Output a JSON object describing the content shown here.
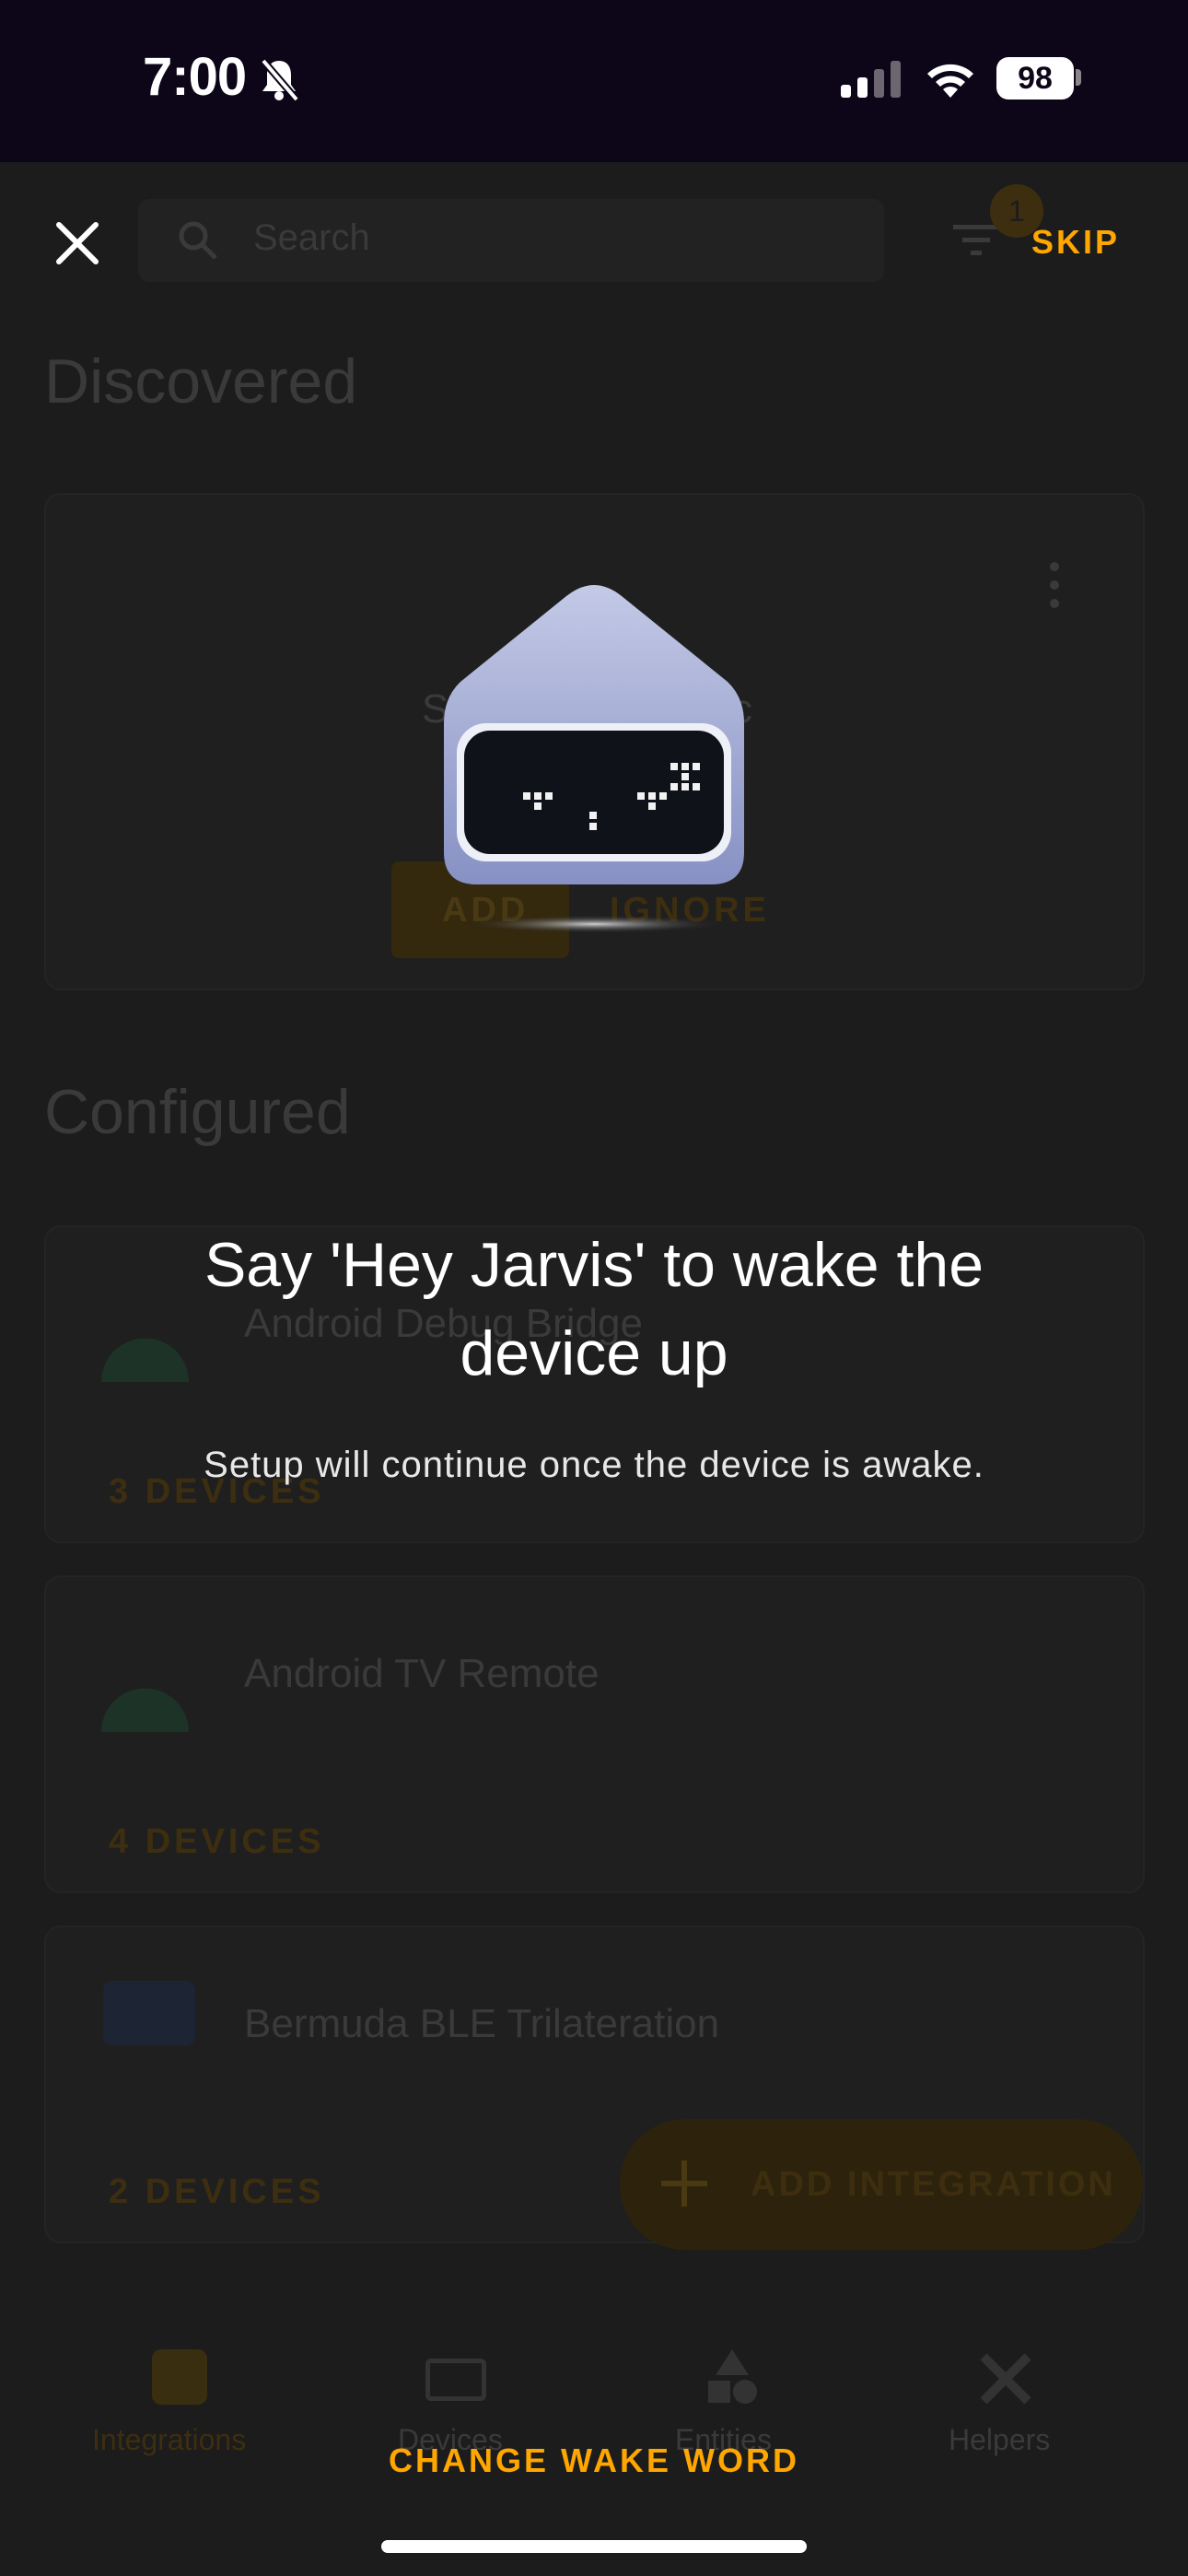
{
  "status_bar": {
    "time": "7:00",
    "battery": "98",
    "icons": [
      "bell-slash-icon",
      "cellular-signal-icon",
      "wifi-icon",
      "battery-icon"
    ]
  },
  "background_screen": {
    "search": {
      "placeholder": "Search"
    },
    "filter_badge": "1",
    "discovered": {
      "title": "Discovered",
      "card_title_start": "S",
      "card_title_end": "c",
      "add_label": "ADD",
      "ignore_label": "IGNORE"
    },
    "configured": {
      "title": "Configured",
      "items": [
        {
          "name": "Android Debug Bridge",
          "count": "3 DEVICES"
        },
        {
          "name": "Android TV Remote",
          "count": "4 DEVICES"
        },
        {
          "name": "Bermuda BLE Trilateration",
          "count": "2 DEVICES"
        }
      ]
    },
    "fab_label": "ADD INTEGRATION",
    "nav": [
      "Integrations",
      "Devices",
      "Entities",
      "Helpers"
    ]
  },
  "overlay": {
    "skip_label": "SKIP",
    "headline": "Say 'Hey Jarvis' to wake the device up",
    "subtitle": "Setup will continue once the device is awake.",
    "change_wake_word_label": "CHANGE WAKE WORD"
  },
  "colors": {
    "accent": "#ffa600",
    "status_bar_bg": "#0d0518",
    "background": "#1c1c1c"
  }
}
